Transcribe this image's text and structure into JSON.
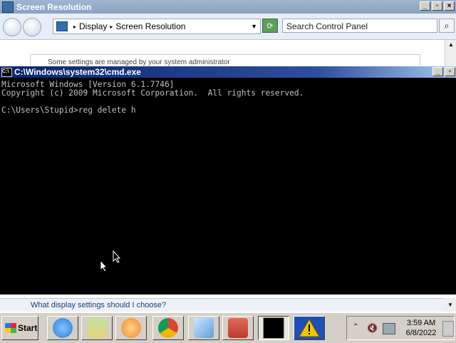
{
  "control_panel": {
    "title": "Screen Resolution",
    "address": {
      "crumb1": "Display",
      "crumb2": "Screen Resolution"
    },
    "search_placeholder": "Search Control Panel",
    "notice": "Some settings are managed by your system administrator",
    "help_link": "What display settings should I choose?"
  },
  "cmd": {
    "title": "C:\\Windows\\system32\\cmd.exe",
    "lines": [
      "Microsoft Windows [Version 6.1.7746]",
      "Copyright (c) 2009 Microsoft Corporation.  All rights reserved.",
      "",
      "C:\\Users\\Stupid>reg delete h"
    ]
  },
  "taskbar": {
    "start_label": "Start",
    "items": [
      {
        "name": "internet-explorer",
        "color": "#2a7fd4"
      },
      {
        "name": "windows-explorer",
        "color": "#e8d27a"
      },
      {
        "name": "media-player",
        "color": "#f08a24"
      },
      {
        "name": "chrome",
        "color": "#3aa14a"
      },
      {
        "name": "control-panel",
        "color": "#5e9fd6"
      },
      {
        "name": "toolbox",
        "color": "#c0392b"
      },
      {
        "name": "cmd",
        "color": "#000000"
      },
      {
        "name": "warning",
        "color": "#f5c400"
      }
    ],
    "clock_time": "3:59 AM",
    "clock_date": "6/8/2022"
  }
}
